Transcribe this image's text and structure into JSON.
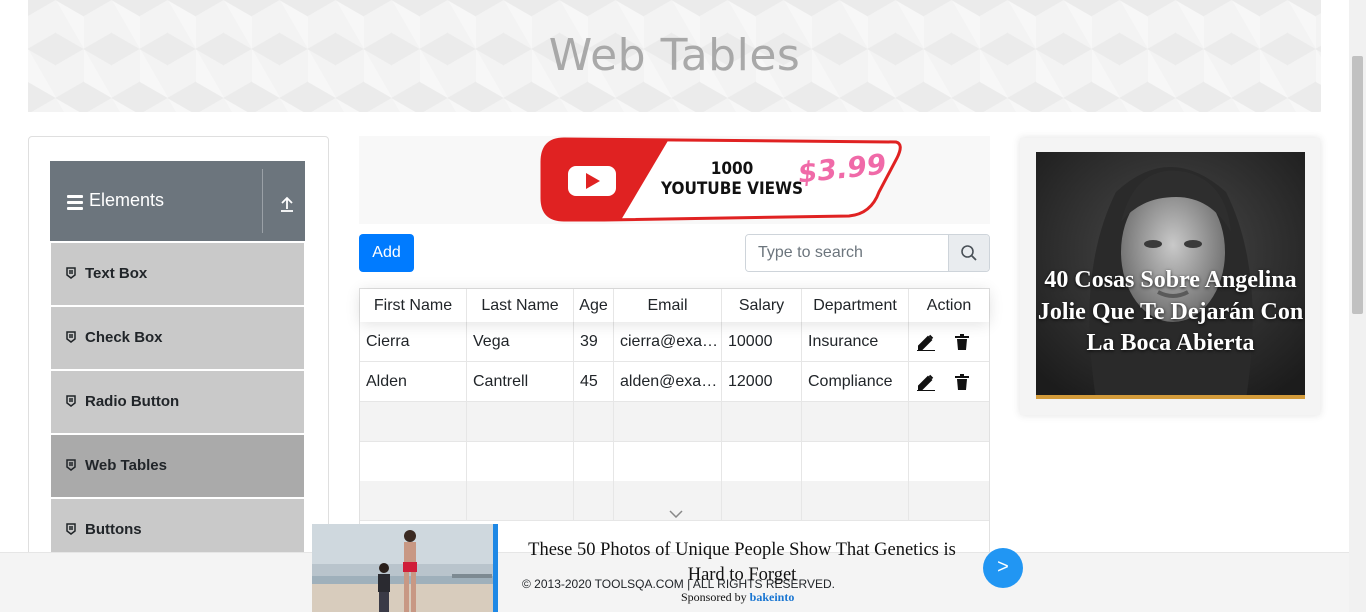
{
  "header": {
    "title": "Web Tables"
  },
  "sidebar": {
    "group_title": "Elements",
    "items": [
      {
        "label": "Text Box"
      },
      {
        "label": "Check Box"
      },
      {
        "label": "Radio Button"
      },
      {
        "label": "Web Tables",
        "active": true
      },
      {
        "label": "Buttons"
      }
    ]
  },
  "top_ad": {
    "line1": "1000",
    "line2": "YOUTUBE VIEWS",
    "price": "$3.99"
  },
  "toolbar": {
    "add_label": "Add",
    "search_placeholder": "Type to search"
  },
  "table": {
    "columns": [
      "First Name",
      "Last Name",
      "Age",
      "Email",
      "Salary",
      "Department",
      "Action"
    ],
    "rows": [
      [
        "Cierra",
        "Vega",
        "39",
        "cierra@example.com",
        "10000",
        "Insurance"
      ],
      [
        "Alden",
        "Cantrell",
        "45",
        "alden@example.com",
        "12000",
        "Compliance"
      ]
    ]
  },
  "side_ad": {
    "caption": "40 Cosas Sobre Angelina Jolie Que Te Dejarán Con La Boca Abierta"
  },
  "bottom_ad": {
    "headline": "These 50 Photos of Unique People Show That Genetics is Hard to Forget",
    "sponsor_prefix": "Sponsored by",
    "sponsor_name": "bakeinto",
    "next_label": ">"
  },
  "footer": {
    "copyright": "© 2013-2020 TOOLSQA.COM | ALL RIGHTS RESERVED."
  },
  "colors": {
    "primary": "#007bff",
    "nav_header": "#6c757d",
    "menu_item": "#c9c9c9",
    "menu_item_active": "#aaaaaa"
  }
}
